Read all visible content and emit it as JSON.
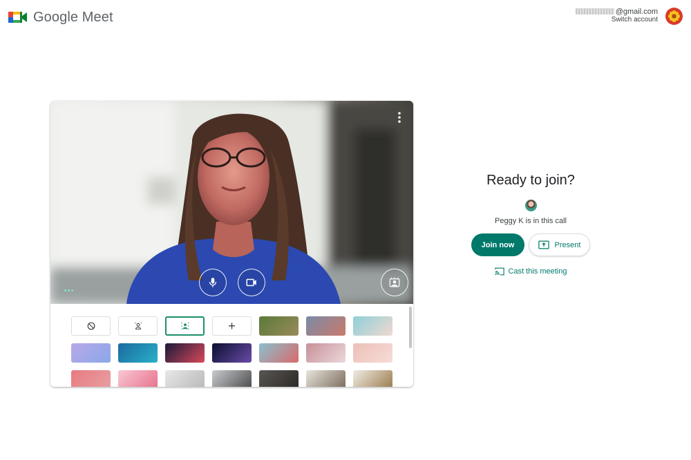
{
  "header": {
    "app_name": "Google Meet",
    "account_email": "@gmail.com",
    "switch_account": "Switch account"
  },
  "join_panel": {
    "title": "Ready to join?",
    "participants_text": "Peggy K is in this call",
    "join_button": "Join now",
    "present_button": "Present",
    "cast_link": "Cast this meeting"
  },
  "preview_controls": {
    "icons": [
      "more-vert-icon",
      "mic-icon",
      "camera-icon",
      "visual-effects-icon"
    ]
  },
  "backgrounds": {
    "options": [
      "no-effect",
      "slight-blur",
      "blur"
    ],
    "selected": "blur",
    "add_label": "+",
    "images": [
      {
        "name": "garden-path",
        "colors": [
          "#5a7a3a",
          "#9a8a5a"
        ]
      },
      {
        "name": "sunset-sky",
        "colors": [
          "#7a8aa8",
          "#c97a6a"
        ]
      },
      {
        "name": "beach",
        "colors": [
          "#8ed0d8",
          "#f0d8d0"
        ]
      },
      {
        "name": "purple-clouds",
        "colors": [
          "#b8a8e8",
          "#8aa8e8"
        ]
      },
      {
        "name": "underwater",
        "colors": [
          "#1a6aa0",
          "#2ab0c8"
        ]
      },
      {
        "name": "nebula",
        "colors": [
          "#1a1a3a",
          "#d8485a"
        ]
      },
      {
        "name": "fireworks",
        "colors": [
          "#0a1030",
          "#6a4aa8"
        ]
      },
      {
        "name": "flowers",
        "colors": [
          "#8ac0d0",
          "#d86a6a"
        ]
      },
      {
        "name": "petals",
        "colors": [
          "#c89098",
          "#ead8da"
        ]
      },
      {
        "name": "pink-sparkle",
        "colors": [
          "#ecc0b8",
          "#f6dcd6"
        ]
      },
      {
        "name": "pink-pattern",
        "colors": [
          "#e87a80",
          "#e8a0a4"
        ]
      },
      {
        "name": "cherry-blossom",
        "colors": [
          "#f8c8d4",
          "#e8708a"
        ]
      },
      {
        "name": "bright-room",
        "colors": [
          "#e8e8e8",
          "#b8b8b8"
        ]
      },
      {
        "name": "office",
        "colors": [
          "#c8ccd0",
          "#4a4a4a"
        ]
      },
      {
        "name": "dark-room",
        "colors": [
          "#5a5652",
          "#2a2826"
        ]
      },
      {
        "name": "shelves",
        "colors": [
          "#e8e4dc",
          "#7a6a5a"
        ]
      },
      {
        "name": "bookshelf",
        "colors": [
          "#f0ece6",
          "#9a7a4a"
        ]
      }
    ]
  },
  "colors": {
    "accent": "#00796b",
    "selected_border": "#1e8e6e"
  }
}
